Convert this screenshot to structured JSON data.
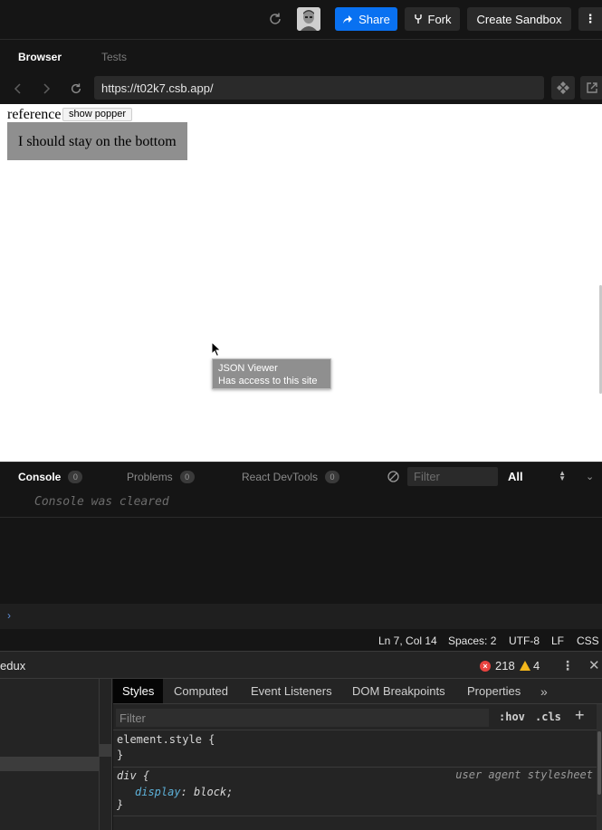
{
  "header": {
    "share_label": "Share",
    "fork_label": "Fork",
    "create_sandbox_label": "Create Sandbox",
    "more_label": "⋮"
  },
  "browser_tabs": [
    {
      "label": "Browser",
      "active": true
    },
    {
      "label": "Tests",
      "active": false
    }
  ],
  "address_bar": {
    "url": "https://t02k7.csb.app/"
  },
  "preview": {
    "reference_text": "reference",
    "popper_button_label": "show popper",
    "box_text": "I should stay on the bottom",
    "tooltip_title": "JSON Viewer",
    "tooltip_subtitle": "Has access to this site"
  },
  "console": {
    "tabs": [
      {
        "label": "Console",
        "count": "0",
        "active": true
      },
      {
        "label": "Problems",
        "count": "0",
        "active": false
      },
      {
        "label": "React DevTools",
        "count": "0",
        "active": false
      }
    ],
    "filter_placeholder": "Filter",
    "level_value": "All",
    "cleared_message": "Console was cleared",
    "prompt_symbol": "›"
  },
  "status_bar": {
    "position": "Ln 7, Col 14",
    "spaces": "Spaces: 2",
    "encoding": "UTF-8",
    "line_ending": "LF",
    "language": "CSS"
  },
  "devtools": {
    "panel_title": "edux",
    "error_count": "218",
    "warning_count": "4",
    "tabs": [
      "Styles",
      "Computed",
      "Event Listeners",
      "DOM Breakpoints",
      "Properties"
    ],
    "more_tabs": "»",
    "filter_placeholder": "Filter",
    "hov_label": ":hov",
    "cls_label": ".cls",
    "add_label": "+",
    "element_style_open": "element.style {",
    "element_style_close": "}",
    "div_selector": "div {",
    "div_property": "display",
    "div_value": ": block;",
    "div_close": "}",
    "user_agent_label": "user agent stylesheet"
  },
  "colors": {
    "accent": "#0971f1",
    "error": "#e8433f",
    "warning": "#f2b61b"
  }
}
